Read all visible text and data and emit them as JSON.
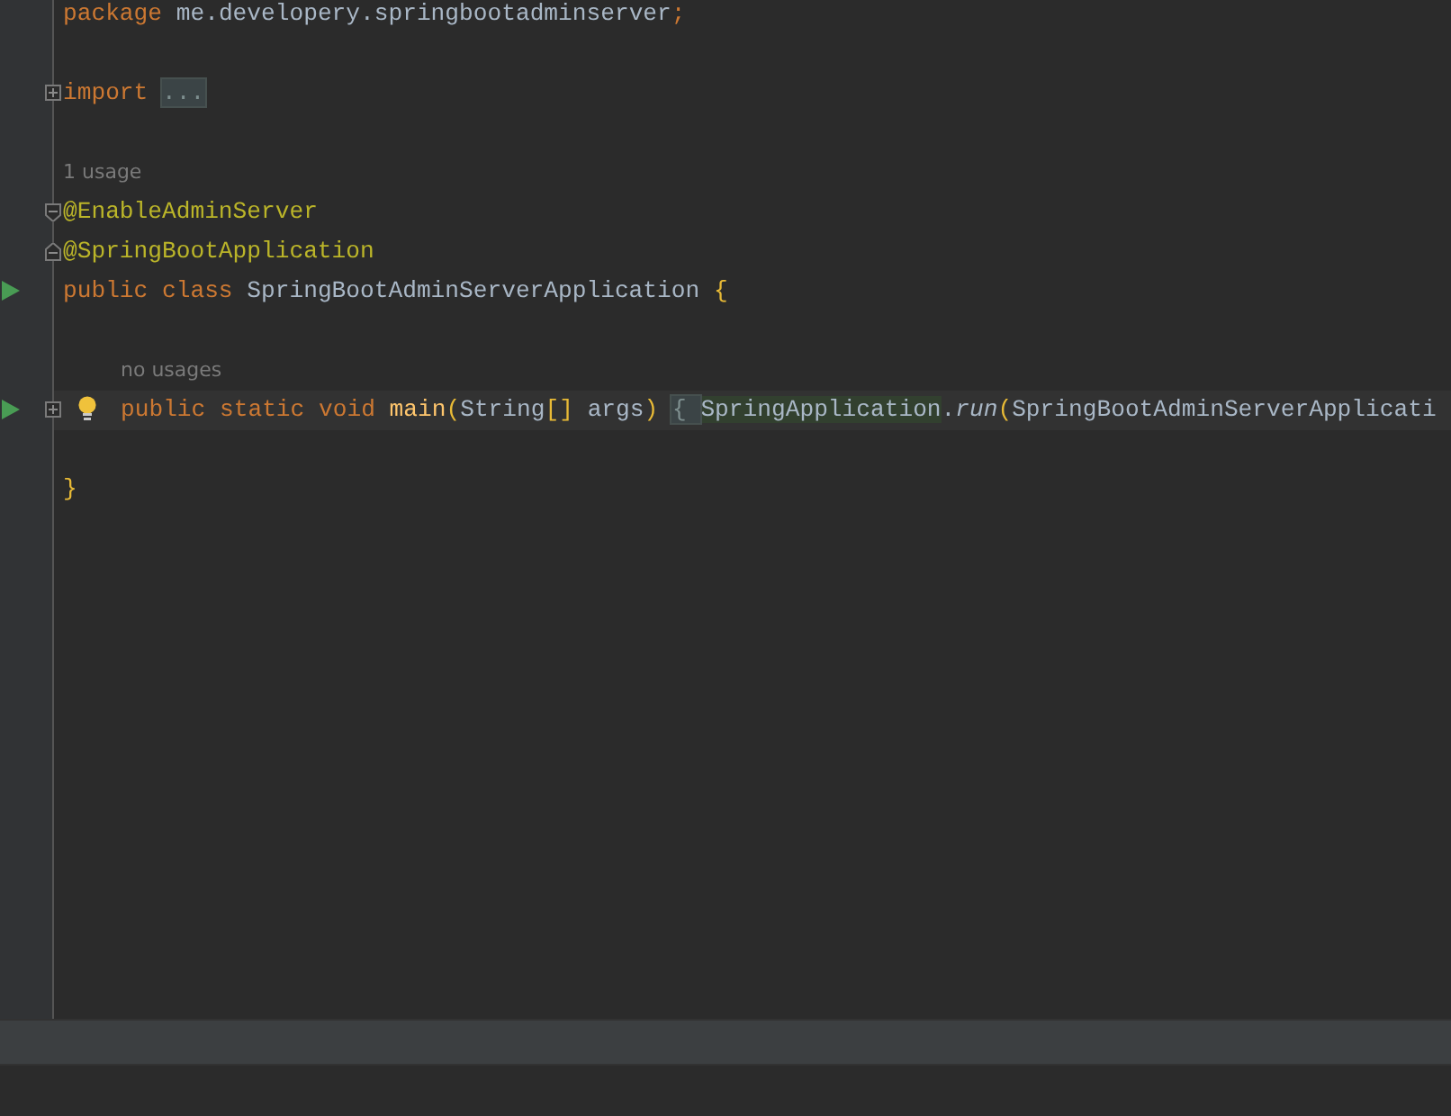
{
  "editor": {
    "lines": [
      {
        "kind": "code",
        "indented": false,
        "current": false,
        "run": false,
        "bulb": false,
        "tokens": [
          {
            "text": "package ",
            "kind": "keyword"
          },
          {
            "text": "me.developery.springbootadminserver",
            "kind": "plain"
          },
          {
            "text": ";",
            "kind": "keyword"
          }
        ]
      },
      {
        "kind": "blank"
      },
      {
        "kind": "code",
        "indented": false,
        "current": false,
        "run": false,
        "bulb": false,
        "fold_marker": {
          "kind": "expand"
        },
        "tokens": [
          {
            "text": "import ",
            "kind": "keyword"
          },
          {
            "text": "...",
            "kind": "placeholder"
          }
        ]
      },
      {
        "kind": "blank"
      },
      {
        "kind": "hint",
        "indented": false,
        "text": "1 usage"
      },
      {
        "kind": "code",
        "indented": false,
        "current": false,
        "run": false,
        "bulb": false,
        "fold_marker": {
          "kind": "collapse-start"
        },
        "tokens": [
          {
            "text": "@EnableAdminServer",
            "kind": "annotation"
          }
        ]
      },
      {
        "kind": "code",
        "indented": false,
        "current": false,
        "run": false,
        "bulb": false,
        "fold_marker": {
          "kind": "collapse-end"
        },
        "tokens": [
          {
            "text": "@SpringBootApplication",
            "kind": "annotation"
          }
        ]
      },
      {
        "kind": "code",
        "indented": false,
        "current": false,
        "run": true,
        "bulb": false,
        "tokens": [
          {
            "text": "public class ",
            "kind": "keyword"
          },
          {
            "text": "SpringBootAdminServerApplication ",
            "kind": "plain"
          },
          {
            "text": "{",
            "kind": "bracket"
          }
        ]
      },
      {
        "kind": "blank"
      },
      {
        "kind": "hint",
        "indented": true,
        "text": "no usages"
      },
      {
        "kind": "code",
        "indented": true,
        "current": true,
        "run": true,
        "bulb": true,
        "fold_marker": {
          "kind": "expand"
        },
        "tokens": [
          {
            "text": "public static void ",
            "kind": "keyword"
          },
          {
            "text": "main",
            "kind": "method"
          },
          {
            "text": "(",
            "kind": "bracket"
          },
          {
            "text": "String",
            "kind": "plain"
          },
          {
            "text": "[]",
            "kind": "bracket"
          },
          {
            "text": " args",
            "kind": "plain"
          },
          {
            "text": ") ",
            "kind": "bracket"
          },
          {
            "text": "{ ",
            "kind": "placeholder"
          },
          {
            "text": "SpringApplication",
            "kind": "folded"
          },
          {
            "text": ".",
            "kind": "plain"
          },
          {
            "text": "run",
            "kind": "static-call"
          },
          {
            "text": "(",
            "kind": "bracket"
          },
          {
            "text": "SpringBootAdminServerApplicati",
            "kind": "plain"
          }
        ]
      },
      {
        "kind": "blank"
      },
      {
        "kind": "code",
        "indented": false,
        "current": false,
        "run": false,
        "bulb": false,
        "tokens": [
          {
            "text": "}",
            "kind": "bracket"
          }
        ]
      }
    ]
  }
}
